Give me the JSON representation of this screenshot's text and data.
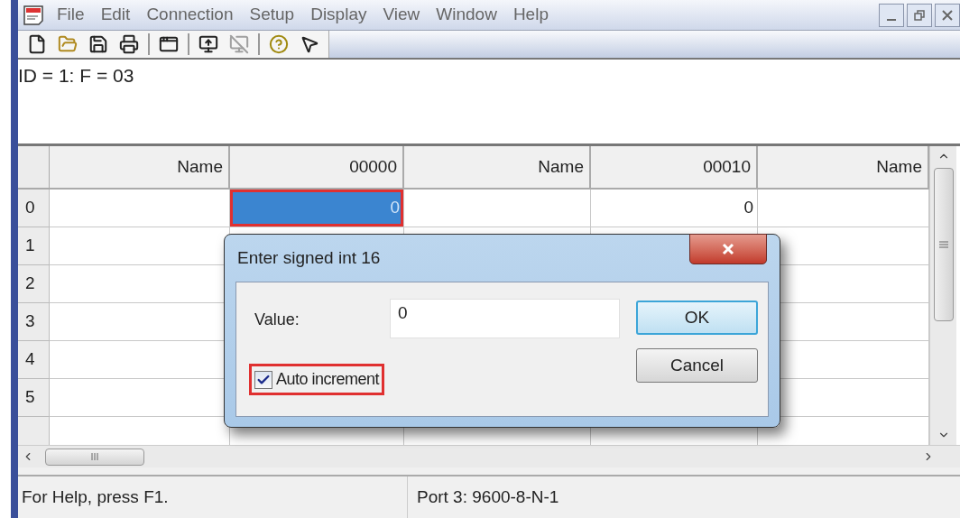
{
  "menu": [
    "File",
    "Edit",
    "Connection",
    "Setup",
    "Display",
    "View",
    "Window",
    "Help"
  ],
  "toolbar": [
    {
      "kind": "new",
      "disabled": false
    },
    {
      "kind": "open",
      "disabled": false
    },
    {
      "kind": "save",
      "disabled": false
    },
    {
      "kind": "print",
      "disabled": false
    },
    {
      "kind": "sep"
    },
    {
      "kind": "window",
      "disabled": false
    },
    {
      "kind": "sep"
    },
    {
      "kind": "connect",
      "disabled": false
    },
    {
      "kind": "disconnect",
      "disabled": true
    },
    {
      "kind": "sep"
    },
    {
      "kind": "help",
      "disabled": false
    },
    {
      "kind": "context-help",
      "disabled": false
    }
  ],
  "info_line": "ID = 1: F = 03",
  "table": {
    "columns": [
      "Name",
      "00000",
      "Name",
      "00010",
      "Name"
    ],
    "rows": [
      {
        "label": "0",
        "cells": [
          {
            "text": "",
            "selected": false,
            "highlighted": false
          },
          {
            "text": "0",
            "selected": true,
            "highlighted": true
          },
          {
            "text": "",
            "selected": false,
            "highlighted": false
          },
          {
            "text": "0",
            "selected": false,
            "highlighted": false
          },
          {
            "text": "",
            "selected": false,
            "highlighted": false
          }
        ]
      },
      {
        "label": "1"
      },
      {
        "label": "2"
      },
      {
        "label": "3"
      },
      {
        "label": "4"
      },
      {
        "label": "5"
      }
    ]
  },
  "dialog": {
    "title": "Enter signed int 16",
    "value_label": "Value:",
    "value": "0",
    "checkbox": {
      "label": "Auto increment",
      "checked": true,
      "highlighted": true
    },
    "buttons": [
      {
        "label": "OK",
        "default": true
      },
      {
        "label": "Cancel",
        "default": false
      }
    ]
  },
  "status_bar": [
    "For Help, press F1.",
    "Port 3: 9600-8-N-1"
  ]
}
